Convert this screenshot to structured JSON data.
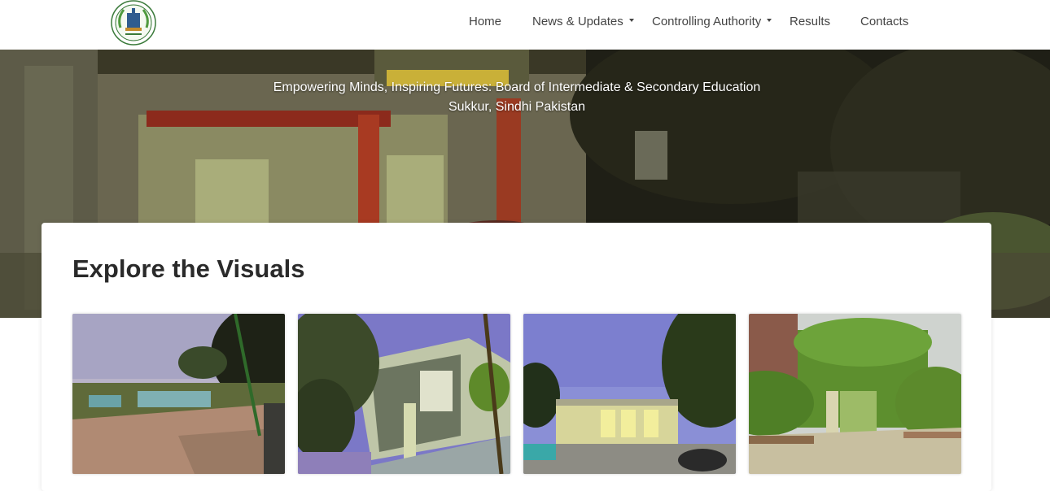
{
  "nav": {
    "logo_icon": "board-emblem-icon",
    "items": [
      {
        "label": "Home",
        "dropdown": false
      },
      {
        "label": "News & Updates",
        "dropdown": true
      },
      {
        "label": "Controlling Authority",
        "dropdown": true
      },
      {
        "label": "Results",
        "dropdown": false
      },
      {
        "label": "Contacts",
        "dropdown": false
      }
    ]
  },
  "hero": {
    "caption_line1": "Empowering Minds, Inspiring Futures: Board of Intermediate & Secondary Education",
    "caption_line2": "Sukkur, Sindhi Pakistan"
  },
  "gallery": {
    "title": "Explore the Visuals",
    "images": [
      {
        "subject": "courtyard-fountain-at-dusk"
      },
      {
        "subject": "building-entrance-pavilion"
      },
      {
        "subject": "building-front-at-twilight"
      },
      {
        "subject": "hedge-archway"
      }
    ]
  },
  "colors": {
    "nav_text": "#444444",
    "title_text": "#2a2a2a",
    "caption_text": "#ffffff"
  }
}
